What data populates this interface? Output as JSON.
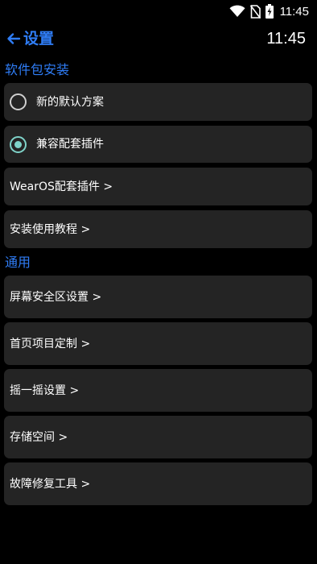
{
  "status_bar": {
    "time": "11:45",
    "icons": [
      "wifi-icon",
      "no-sim-icon",
      "battery-charging-icon"
    ]
  },
  "header": {
    "back_icon": "arrow-left-icon",
    "title": "设置",
    "clock": "11:45"
  },
  "colors": {
    "accent": "#2f7df6",
    "card_bg": "#242424",
    "radio_checked": "#7fd3c9",
    "background": "#000000"
  },
  "sections": {
    "package": {
      "title": "软件包安装",
      "options": [
        {
          "label": "新的默认方案",
          "selected": false
        },
        {
          "label": "兼容配套插件",
          "selected": true
        }
      ],
      "links": [
        {
          "label": "WearOS配套插件 >"
        },
        {
          "label": "安装使用教程 >"
        }
      ]
    },
    "general": {
      "title": "通用",
      "links": [
        {
          "label": "屏幕安全区设置 >"
        },
        {
          "label": "首页项目定制 >"
        },
        {
          "label": "摇一摇设置 >"
        },
        {
          "label": "存储空间 >"
        },
        {
          "label": "故障修复工具 >"
        }
      ]
    }
  }
}
